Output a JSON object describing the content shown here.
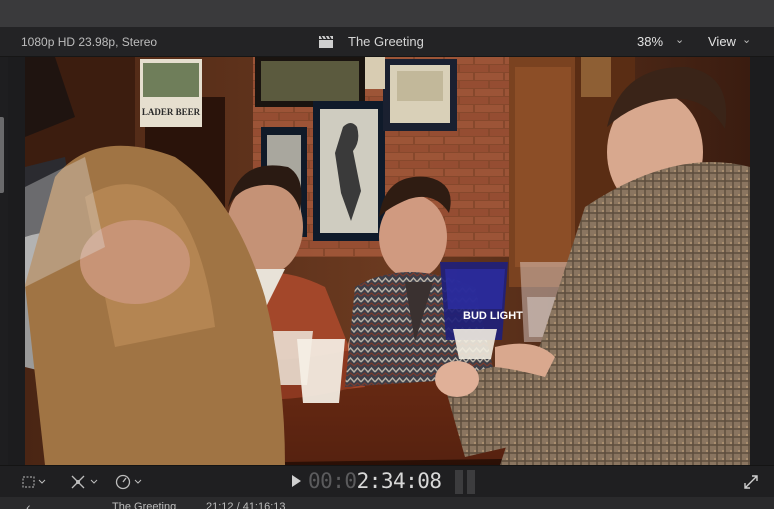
{
  "viewer": {
    "format": "1080p HD 23.98p, Stereo",
    "title": "The Greeting",
    "zoom": "38%",
    "view_label": "View"
  },
  "controls": {
    "timecode_dim": "00:0",
    "timecode_lit": "2:34:08"
  },
  "timeline": {
    "project": "The Greeting",
    "duration": "21:12 / 41:16:13"
  },
  "frame": {
    "sign_text": "LADER BEER",
    "pitcher_text": "BUD LIGHT",
    "icons": [
      "clapper-icon",
      "crop-icon",
      "transform-icon",
      "speed-icon",
      "play-icon",
      "fullscreen-icon"
    ]
  }
}
